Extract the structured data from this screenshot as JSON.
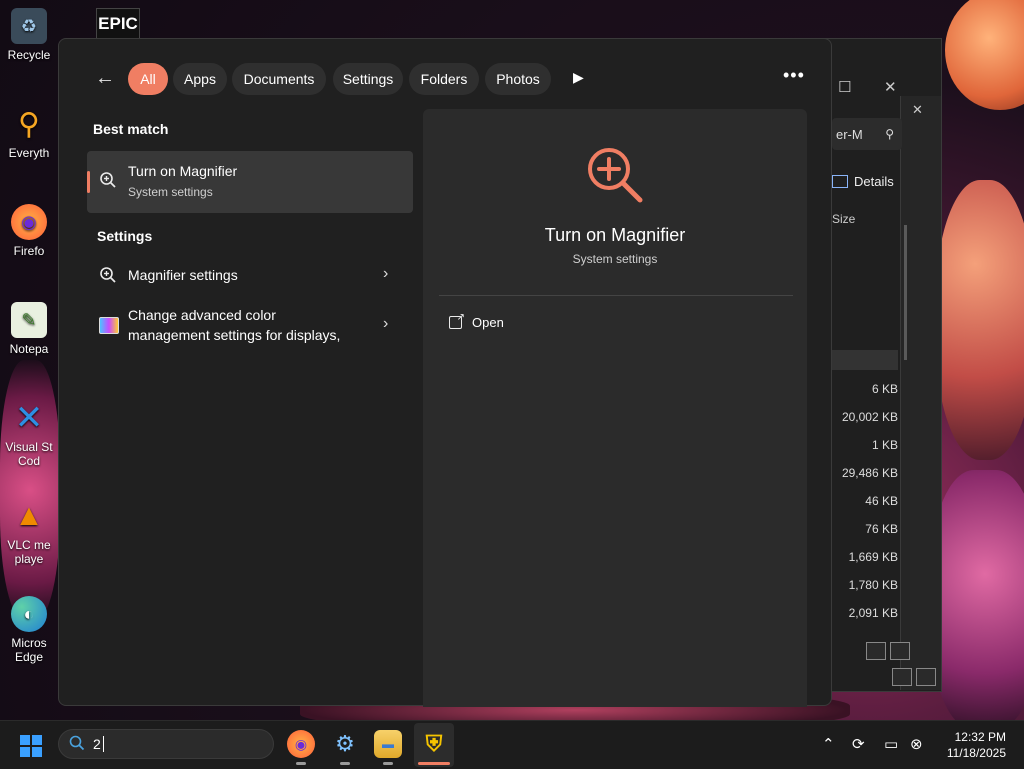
{
  "desktop": {
    "icons": [
      {
        "label": "Recycle",
        "glyph": "♻",
        "color": "#9fc7e8"
      },
      {
        "label": "Everyth",
        "glyph": "⚲",
        "color": "#f5a623"
      },
      {
        "label": "Firefo",
        "glyph": "🦊",
        "color": "#ff7139"
      },
      {
        "label": "Notepa",
        "glyph": "✎",
        "color": "#7fbf6a"
      },
      {
        "label": "Visual St Cod",
        "glyph": "✕",
        "color": "#2d8fe3"
      },
      {
        "label": "VLC me playe",
        "glyph": "▲",
        "color": "#f08a00"
      },
      {
        "label": "Micros Edge",
        "glyph": "◐",
        "color": "#2fa3e6"
      }
    ],
    "epic_label": "EPIC"
  },
  "explorer": {
    "search_text": "er-M",
    "details_label": "Details",
    "size_header": "Size",
    "sizes": [
      "6 KB",
      "20,002 KB",
      "1 KB",
      "29,486 KB",
      "46 KB",
      "76 KB",
      "1,669 KB",
      "1,780 KB",
      "2,091 KB"
    ]
  },
  "search_panel": {
    "filters": [
      {
        "label": "All",
        "active": true
      },
      {
        "label": "Apps",
        "active": false
      },
      {
        "label": "Documents",
        "active": false
      },
      {
        "label": "Settings",
        "active": false
      },
      {
        "label": "Folders",
        "active": false
      },
      {
        "label": "Photos",
        "active": false
      }
    ],
    "best_match_heading": "Best match",
    "best_match": {
      "title": "Turn on Magnifier",
      "subtitle": "System settings"
    },
    "settings_heading": "Settings",
    "settings_items": [
      {
        "title": "Magnifier settings"
      },
      {
        "title_line1": "Change advanced color",
        "title_line2": "management settings for displays,"
      }
    ],
    "preview": {
      "title": "Turn on Magnifier",
      "subtitle": "System settings",
      "action_open": "Open",
      "accent_color": "#f07e63"
    }
  },
  "taskbar": {
    "search_text": "2",
    "apps": [
      {
        "name": "firefox",
        "glyph": "◉",
        "color": "#ff7139"
      },
      {
        "name": "settings",
        "glyph": "⚙",
        "color": "#4aa3df"
      },
      {
        "name": "file-explorer",
        "glyph": "▬",
        "color": "#f2c14e"
      },
      {
        "name": "security-shield",
        "glyph": "⛨",
        "color": "#3a8ee6"
      }
    ],
    "time": "12:32 PM",
    "date": "11/18/2025"
  }
}
